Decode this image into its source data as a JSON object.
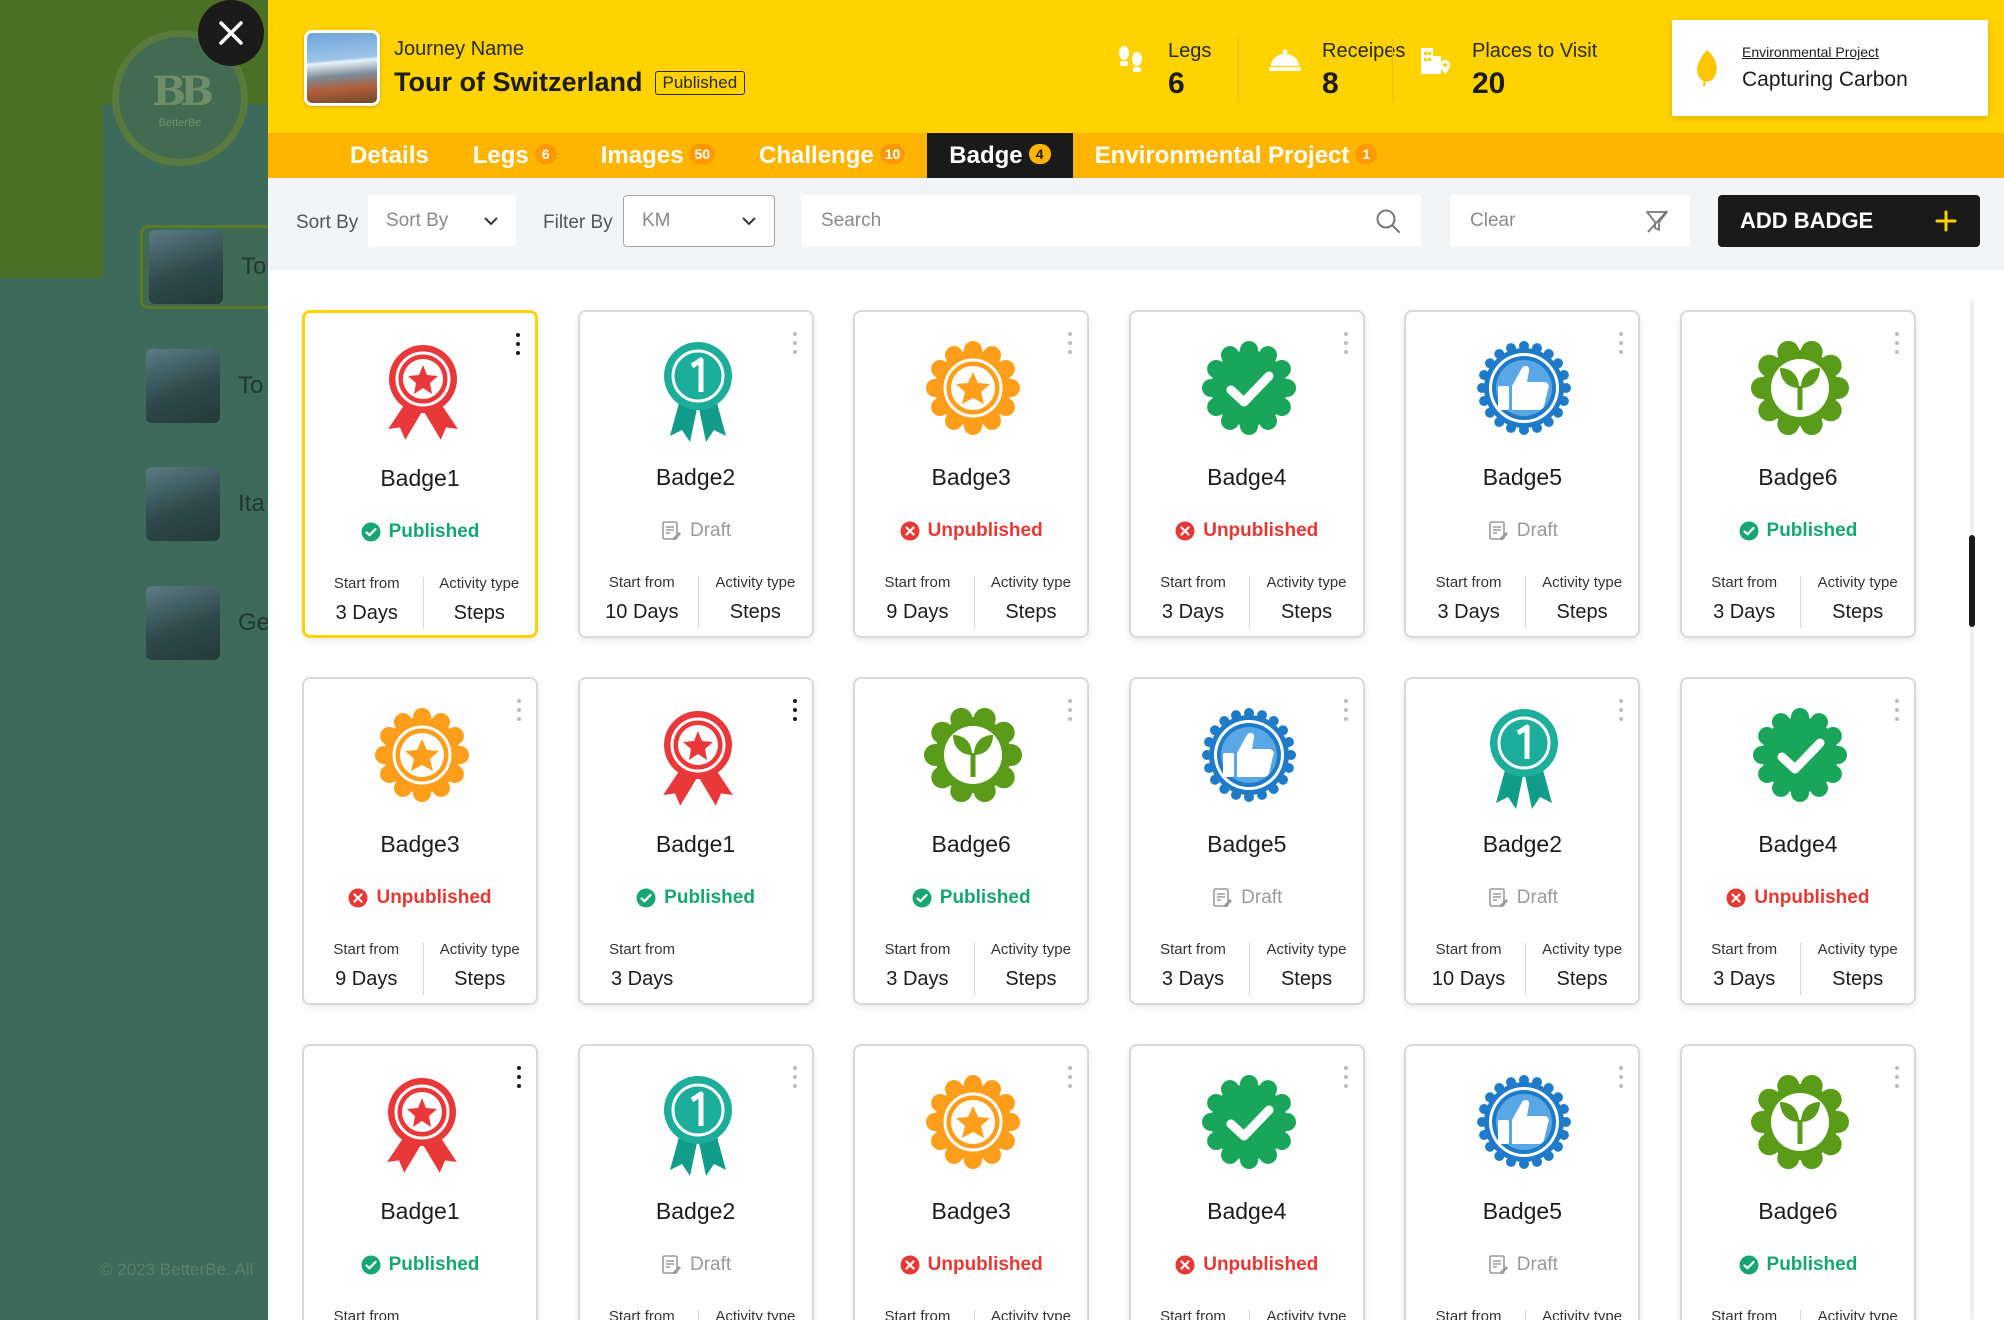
{
  "background": {
    "logo_text": "BetterBe",
    "items": [
      "To",
      "To",
      "Ita",
      "Ge"
    ],
    "copyright": "© 2023 BetterBe. All"
  },
  "header": {
    "journey_label": "Journey Name",
    "journey_title": "Tour of Switzerland",
    "journey_status": "Published",
    "stats": [
      {
        "label": "Legs",
        "value": "6",
        "icon": "footsteps-icon"
      },
      {
        "label": "Receipes",
        "value": "8",
        "icon": "dish-icon"
      },
      {
        "label": "Places to Visit",
        "value": "20",
        "icon": "buildings-pin-icon"
      }
    ],
    "env_project": {
      "label": "Environmental Project",
      "value": "Capturing Carbon",
      "icon": "leaf-icon"
    }
  },
  "tabs": [
    {
      "label": "Details",
      "count": ""
    },
    {
      "label": "Legs",
      "count": "6"
    },
    {
      "label": "Images",
      "count": "50"
    },
    {
      "label": "Challenge",
      "count": "10"
    },
    {
      "label": "Badge",
      "count": "4",
      "active": true
    },
    {
      "label": "Environmental Project",
      "count": "1"
    }
  ],
  "toolbar": {
    "sort_label": "Sort By",
    "sort_value": "Sort By",
    "filter_label": "Filter By",
    "filter_value": "KM",
    "search_placeholder": "Search",
    "clear_label": "Clear",
    "add_label": "ADD BADGE"
  },
  "info_labels": {
    "start": "Start from",
    "activity": "Activity type"
  },
  "colors": {
    "yellow": "#ffd200",
    "orange_tab": "#ffb400",
    "published": "#17a673",
    "unpublished": "#e53935",
    "dark": "#1a1a1a"
  },
  "badges": [
    {
      "name": "Badge1",
      "icon": "rosette-star-icon",
      "status": "Published",
      "start": "3 Days",
      "activity": "Steps",
      "selected": true
    },
    {
      "name": "Badge2",
      "icon": "ribbon-number-one-icon",
      "status": "Draft",
      "start": "10 Days",
      "activity": "Steps"
    },
    {
      "name": "Badge3",
      "icon": "seal-star-icon",
      "status": "Unpublished",
      "start": "9 Days",
      "activity": "Steps"
    },
    {
      "name": "Badge4",
      "icon": "seal-check-icon",
      "status": "Unpublished",
      "start": "3 Days",
      "activity": "Steps"
    },
    {
      "name": "Badge5",
      "icon": "seal-thumbs-up-icon",
      "status": "Draft",
      "start": "3 Days",
      "activity": "Steps"
    },
    {
      "name": "Badge6",
      "icon": "seal-sprout-icon",
      "status": "Published",
      "start": "3 Days",
      "activity": "Steps"
    },
    {
      "name": "Badge3",
      "icon": "seal-star-icon",
      "status": "Unpublished",
      "start": "9 Days",
      "activity": "Steps"
    },
    {
      "name": "Badge1",
      "icon": "rosette-star-icon",
      "status": "Published",
      "start": "3 Days",
      "activity": ""
    },
    {
      "name": "Badge6",
      "icon": "seal-sprout-icon",
      "status": "Published",
      "start": "3 Days",
      "activity": "Steps"
    },
    {
      "name": "Badge5",
      "icon": "seal-thumbs-up-icon",
      "status": "Draft",
      "start": "3 Days",
      "activity": "Steps"
    },
    {
      "name": "Badge2",
      "icon": "ribbon-number-one-icon",
      "status": "Draft",
      "start": "10 Days",
      "activity": "Steps"
    },
    {
      "name": "Badge4",
      "icon": "seal-check-icon",
      "status": "Unpublished",
      "start": "3 Days",
      "activity": "Steps"
    },
    {
      "name": "Badge1",
      "icon": "rosette-star-icon",
      "status": "Published",
      "start": "",
      "activity": ""
    },
    {
      "name": "Badge2",
      "icon": "ribbon-number-one-icon",
      "status": "Draft",
      "start": "",
      "activity": ""
    },
    {
      "name": "Badge3",
      "icon": "seal-star-icon",
      "status": "Unpublished",
      "start": "",
      "activity": ""
    },
    {
      "name": "Badge4",
      "icon": "seal-check-icon",
      "status": "Unpublished",
      "start": "",
      "activity": ""
    },
    {
      "name": "Badge5",
      "icon": "seal-thumbs-up-icon",
      "status": "Draft",
      "start": "",
      "activity": ""
    },
    {
      "name": "Badge6",
      "icon": "seal-sprout-icon",
      "status": "Published",
      "start": "",
      "activity": ""
    }
  ]
}
